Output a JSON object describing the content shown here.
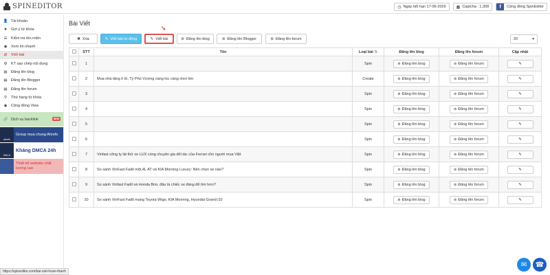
{
  "app": {
    "logo_text": "SPINEDITOR"
  },
  "topbar": {
    "expiry": "Ngày tiết hạn 17-06-2026",
    "captcha": "Captcha : 1,308",
    "community": "Cộng đồng SpinEditor",
    "fb_letter": "f"
  },
  "sidebar": {
    "items": [
      {
        "label": "Tài khoản",
        "icon": "user-icon",
        "glyph": "👤"
      },
      {
        "label": "Gợi ý từ khóa",
        "icon": "star-icon",
        "glyph": "★"
      },
      {
        "label": "Kiểm tra tên miền",
        "icon": "check-list-icon",
        "glyph": "☰"
      },
      {
        "label": "Xem tin nhanh",
        "icon": "eye-icon",
        "glyph": "◉"
      },
      {
        "label": "Viết bài",
        "icon": "shuffle-icon",
        "glyph": "⇄",
        "active": true
      },
      {
        "label": "KT sao chép nội dung",
        "icon": "gear-icon",
        "glyph": "⚙"
      },
      {
        "label": "Đăng lên blog",
        "icon": "list-icon",
        "glyph": "▤"
      },
      {
        "label": "Đăng lên Blogger",
        "icon": "list-icon",
        "glyph": "▤"
      },
      {
        "label": "Đăng lên forum",
        "icon": "list-icon",
        "glyph": "▤"
      },
      {
        "label": "Thứ hạng từ khóa",
        "icon": "search-icon",
        "glyph": "⚲"
      },
      {
        "label": "Cộng đồng View",
        "icon": "eye-icon",
        "glyph": "◉"
      }
    ],
    "backlink": {
      "label": "Dịch vụ backlink",
      "badge": "NEW"
    },
    "banners": [
      {
        "thumb": "ahrefs",
        "text": "Group mua chung Ahrefs"
      },
      {
        "thumb": "DMCA",
        "text": "Kháng DMCA 24h"
      },
      {
        "thumb": "",
        "text": "Thiết kế website chất lượng cao"
      }
    ]
  },
  "main": {
    "title": "Bài Viết",
    "toolbar": {
      "delete": "Xóa",
      "auto_write": "Viết bài tự động",
      "write": "Viết bài",
      "post_blog": "Đăng lên blog",
      "post_blogger": "Đăng lên Blogger",
      "post_forum": "Đăng lên forum",
      "page_size": "20"
    },
    "columns": [
      "STT",
      "Tên",
      "Loại bài",
      "Đăng lên blog",
      "Đăng lên forum",
      "Cập nhật"
    ],
    "row_button_blog": "Đăng lên blog",
    "row_button_forum": "Đăng lên forum",
    "rows": [
      {
        "stt": "1",
        "name": "",
        "type": "Spin"
      },
      {
        "stt": "2",
        "name": "Mua nhà tặng ô tô, Tỷ Phú Vượng càng lúc càng chơi lớn",
        "type": "Create"
      },
      {
        "stt": "3",
        "name": "",
        "type": "Spin"
      },
      {
        "stt": "4",
        "name": "",
        "type": "Spin"
      },
      {
        "stt": "5",
        "name": "",
        "type": "Spin"
      },
      {
        "stt": "6",
        "name": "",
        "type": "Spin"
      },
      {
        "stt": "7",
        "name": "Vinfast công ty lái thử xe LUX cùng chuyên gia đối tác của Ferrari cho người mua Việt",
        "type": "Spin"
      },
      {
        "stt": "8",
        "name": "So sánh VinFast Fadil một,4L AT và KIA Morning Luxury: Nên chọn xe nào?",
        "type": "Spin"
      },
      {
        "stt": "9",
        "name": "So sánh Vinfast Fadil và Honda Brio, đâu là chiếc xe đáng để tìm hơn?",
        "type": "Spin"
      },
      {
        "stt": "10",
        "name": "So sánh VinFast Fadil mang Toyota Wigo, KIA Morning, Hyundai Grand i10",
        "type": "Spin"
      }
    ]
  },
  "statusbar": {
    "url": "https://spineditor.com/bai-viet-hoan-thanh"
  }
}
